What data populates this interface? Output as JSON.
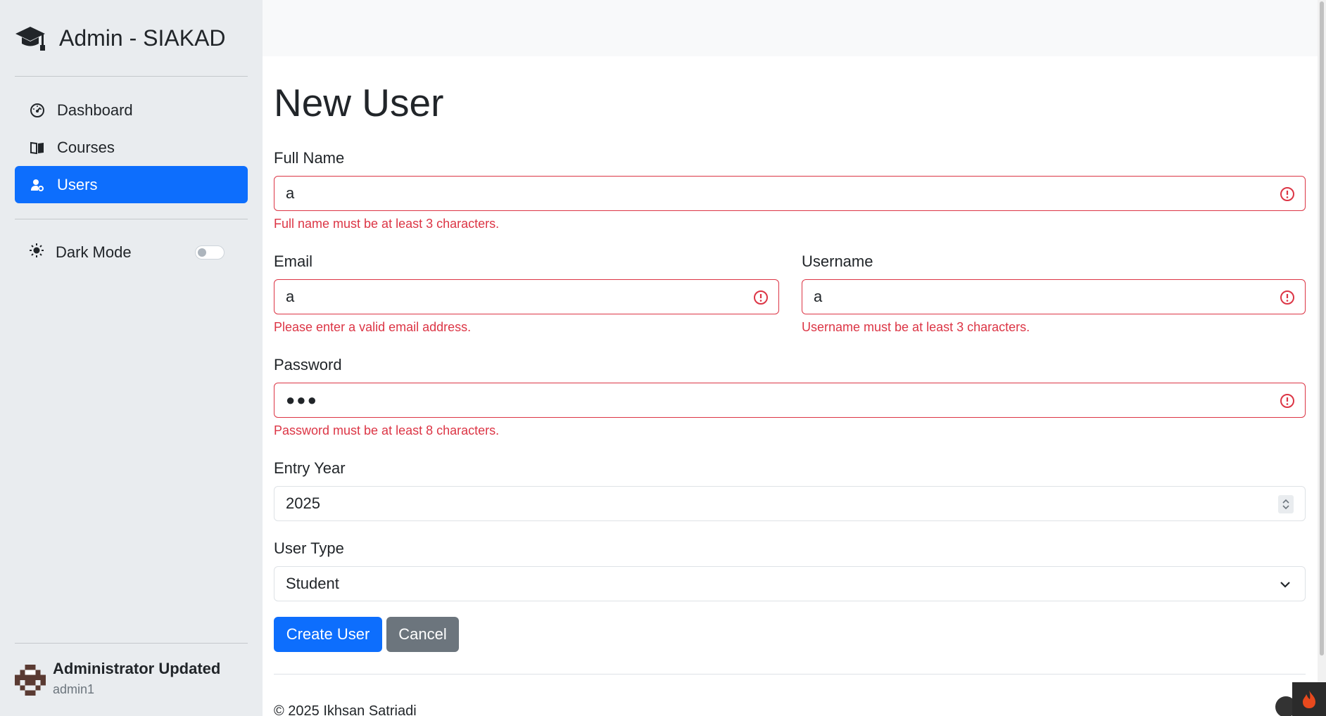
{
  "sidebar": {
    "brand": "Admin - SIAKAD",
    "brand_icon": "graduation-cap-icon",
    "items": [
      {
        "label": "Dashboard",
        "icon": "speedometer-icon"
      },
      {
        "label": "Courses",
        "icon": "book-icon"
      },
      {
        "label": "Users",
        "icon": "user-gear-icon",
        "active": true
      }
    ],
    "dark_mode_label": "Dark Mode",
    "dark_mode_on": false,
    "user": {
      "name": "Administrator Updated",
      "handle": "admin1"
    }
  },
  "form": {
    "title": "New User",
    "full_name": {
      "label": "Full Name",
      "value": "a",
      "error": "Full name must be at least 3 characters."
    },
    "email": {
      "label": "Email",
      "value": "a",
      "error": "Please enter a valid email address."
    },
    "username": {
      "label": "Username",
      "value": "a",
      "error": "Username must be at least 3 characters."
    },
    "password": {
      "label": "Password",
      "value": "●●●",
      "error": "Password must be at least 8 characters."
    },
    "entry_year": {
      "label": "Entry Year",
      "value": "2025"
    },
    "user_type": {
      "label": "User Type",
      "value": "Student"
    },
    "create_label": "Create User",
    "cancel_label": "Cancel"
  },
  "footer": {
    "text": "© 2025 Ikhsan Satriadi"
  },
  "colors": {
    "primary": "#0d6efd",
    "danger": "#dc3545",
    "secondary": "#6c757d",
    "sidebar_bg": "#e9ecef"
  }
}
